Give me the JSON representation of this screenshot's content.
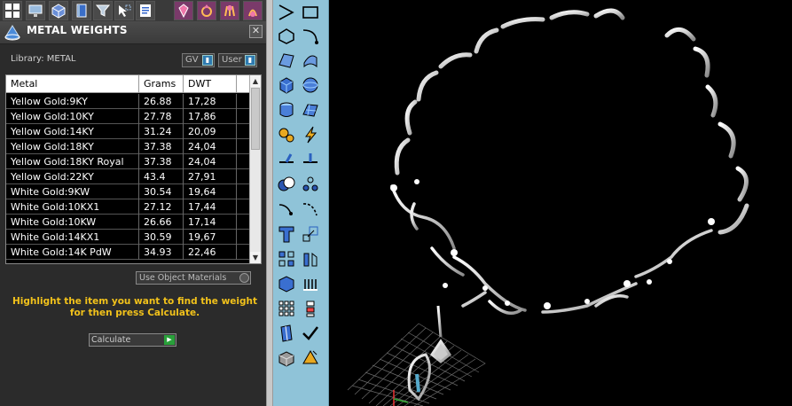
{
  "panel": {
    "title": "METAL WEIGHTS",
    "close_label": "✕",
    "library_label": "Library: METAL",
    "unit_gv": "GV",
    "unit_user": "User",
    "use_object_materials": "Use Object Materials",
    "instructions": "Highlight the item you want to find the weight for then press Calculate.",
    "calculate_label": "Calculate",
    "calculate_icon": "play-icon"
  },
  "table": {
    "headers": {
      "metal": "Metal",
      "grams": "Grams",
      "dwt": "DWT"
    },
    "rows": [
      {
        "metal": "Yellow Gold:9KY",
        "grams": "26.88",
        "dwt": "17,28"
      },
      {
        "metal": "Yellow Gold:10KY",
        "grams": "27.78",
        "dwt": "17,86"
      },
      {
        "metal": "Yellow Gold:14KY",
        "grams": "31.24",
        "dwt": "20,09"
      },
      {
        "metal": "Yellow Gold:18KY",
        "grams": "37.38",
        "dwt": "24,04"
      },
      {
        "metal": "Yellow Gold:18KY Royal",
        "grams": "37.38",
        "dwt": "24,04"
      },
      {
        "metal": "Yellow Gold:22KY",
        "grams": "43.4",
        "dwt": "27,91"
      },
      {
        "metal": "White Gold:9KW",
        "grams": "30.54",
        "dwt": "19,64"
      },
      {
        "metal": "White Gold:10KX1",
        "grams": "27.12",
        "dwt": "17,44"
      },
      {
        "metal": "White Gold:10KW",
        "grams": "26.66",
        "dwt": "17,14"
      },
      {
        "metal": "White Gold:14KX1",
        "grams": "30.59",
        "dwt": "19,67"
      },
      {
        "metal": "White Gold:14K PdW",
        "grams": "34.93",
        "dwt": "22,46"
      }
    ]
  },
  "colors": {
    "instruction_text": "#f2c21b",
    "palette_bg": "#8fc3d8",
    "panel_bg": "#2b2b2b",
    "model_silver": "#e6e6e6"
  },
  "toolbar_icons": [
    "windows-icon",
    "monitor-icon",
    "cube-icon",
    "book-icon",
    "funnel-icon",
    "select-icon",
    "document-icon",
    "gem-icon",
    "ring-setting-icon",
    "prong-icon",
    "bail-icon"
  ],
  "palette_icons": [
    "curve-icon",
    "rectangle-icon",
    "polygon-icon",
    "arc-icon",
    "surface-icon",
    "loft-icon",
    "box-icon",
    "sphere-icon",
    "cylinder-icon",
    "mesh-icon",
    "gear-icon",
    "lightning-icon",
    "extrude-icon",
    "profile-icon",
    "boolean-icon",
    "dots-icon",
    "trim-icon",
    "fillet-icon",
    "text-icon",
    "scale-icon",
    "array-icon",
    "mirror-icon",
    "solid-icon",
    "pipes-icon",
    "grid-icon",
    "stack-icon",
    "cut-icon",
    "checkmark-icon",
    "cube-gray-icon",
    "pyramid-icon"
  ]
}
